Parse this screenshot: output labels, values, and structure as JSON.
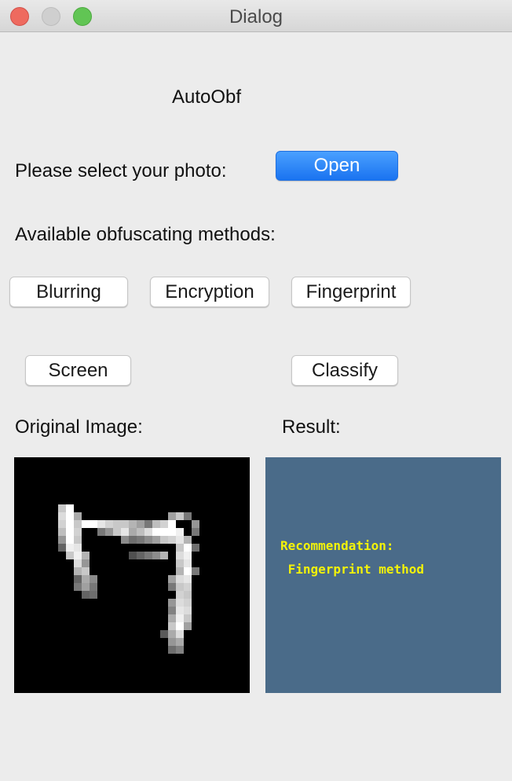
{
  "window": {
    "title": "Dialog"
  },
  "header": {
    "app_name": "AutoObf"
  },
  "select_photo": {
    "label": "Please select your photo:",
    "open_button": "Open"
  },
  "methods": {
    "label": "Available obfuscating methods:",
    "buttons": [
      "Blurring",
      "Encryption",
      "Fingerprint",
      "Screen"
    ]
  },
  "classify_button": "Classify",
  "original": {
    "label": "Original Image:"
  },
  "result": {
    "label": "Result:",
    "line1": "Recommendation:",
    "line2": " Fingerprint method",
    "background_color": "#4a6b89",
    "text_color": "#f2f20a"
  },
  "colors": {
    "accent": "#1a73f0",
    "window_bg": "#ececec"
  }
}
